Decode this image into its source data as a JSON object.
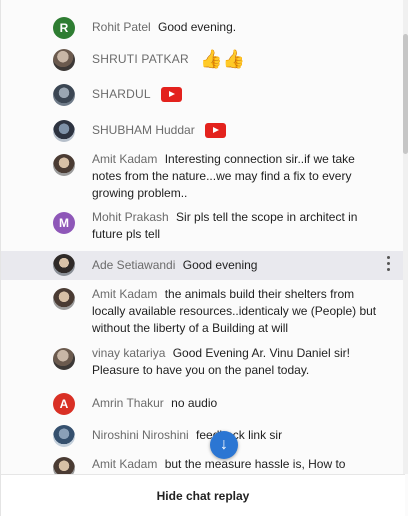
{
  "messages": [
    {
      "author": "Rohit Patel",
      "text": "Good evening.",
      "avatar_letter": "R",
      "avatar_color": "#2e7d32"
    },
    {
      "author": "SHRUTI PATKAR",
      "text": "",
      "avatar_icon": "photo-avatar-icon",
      "emoji": "👍👍"
    },
    {
      "author": "SHARDUL",
      "text": "",
      "avatar_icon": "photo-avatar-icon",
      "badge": "youtube-badge-icon"
    },
    {
      "author": "SHUBHAM Huddar",
      "text": "",
      "avatar_icon": "photo-avatar-icon",
      "badge": "youtube-badge-icon"
    },
    {
      "author": "Amit Kadam",
      "text": "Interesting connection sir..if we take notes from the nature...we may find a fix to every growing problem..",
      "avatar_icon": "photo-avatar-icon"
    },
    {
      "author": "Mohit Prakash",
      "text": "Sir pls tell the scope in architect in future pls tell",
      "avatar_letter": "M",
      "avatar_color": "#8e57b8"
    },
    {
      "author": "Ade Setiawandi",
      "text": "Good evening",
      "avatar_icon": "photo-avatar-icon"
    },
    {
      "author": "Amit Kadam",
      "text": "the animals build their shelters from locally available resources..identicaly we (People) but without the liberty of a Building at will",
      "avatar_icon": "photo-avatar-icon"
    },
    {
      "author": "vinay katariya",
      "text": "Good Evening Ar. Vinu Daniel sir! Pleasure to have you on the panel today.",
      "avatar_icon": "photo-avatar-icon"
    },
    {
      "author": "Amrin Thakur",
      "text": "no audio",
      "avatar_letter": "A",
      "avatar_color": "#d93025"
    },
    {
      "author": "Niroshini Niroshini",
      "text": "feedback link sir",
      "avatar_icon": "photo-avatar-icon"
    },
    {
      "author": "Amit Kadam",
      "text": "but the measure hassle is, How to",
      "avatar_icon": "photo-avatar-icon"
    }
  ],
  "scroll_down_icon": "arrow-down-icon",
  "footer": {
    "hide_label": "Hide chat replay"
  }
}
